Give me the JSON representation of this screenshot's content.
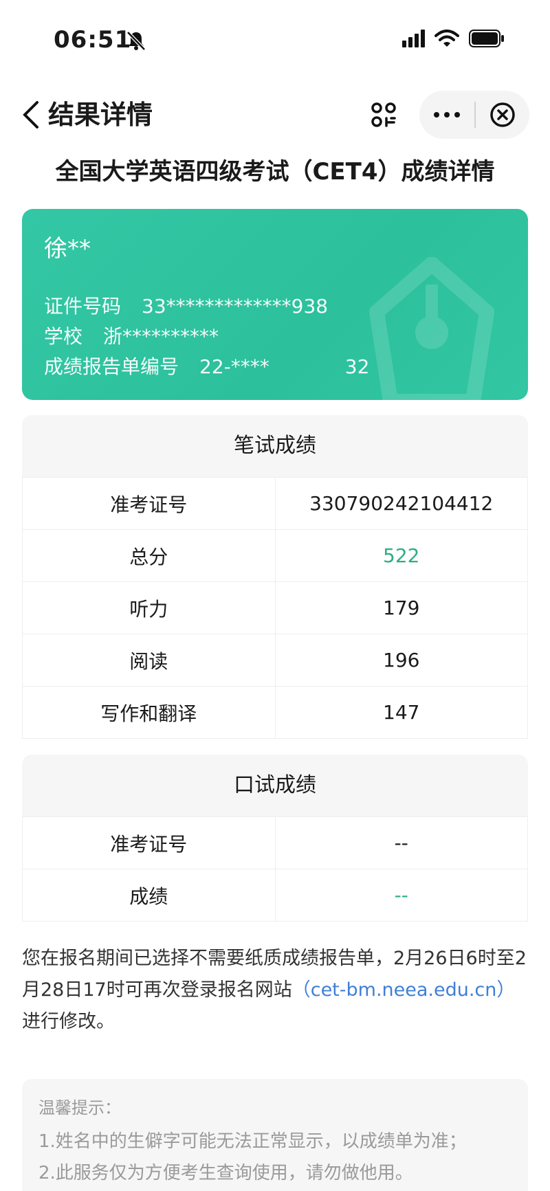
{
  "status_bar": {
    "time": "06:51",
    "icons": [
      "bell-off-icon",
      "signal-icon",
      "wifi-icon",
      "battery-icon"
    ]
  },
  "nav": {
    "back_icon": "chevron-left-icon",
    "title": "结果详情",
    "qr_icon": "qr-scan-icon",
    "more_icon": "more-dots-icon",
    "close_icon": "close-circle-icon"
  },
  "page_title": "全国大学英语四级考试（CET4）成绩详情",
  "card": {
    "name": "徐**",
    "id_label": "证件号码",
    "id_value": "33*************938",
    "school_label": "学校",
    "school_value": "浙**********",
    "report_label": "成绩报告单编号",
    "report_value": "22-****",
    "report_suffix": "32",
    "colors": {
      "background": "#2fc4a0",
      "text": "#ffffff"
    }
  },
  "written": {
    "title": "笔试成绩",
    "rows": [
      {
        "label": "准考证号",
        "value": "330790242104412"
      },
      {
        "label": "总分",
        "value": "522"
      },
      {
        "label": "听力",
        "value": "179"
      },
      {
        "label": "阅读",
        "value": "196"
      },
      {
        "label": "写作和翻译",
        "value": "147"
      }
    ]
  },
  "oral": {
    "title": "口试成绩",
    "rows": [
      {
        "label": "准考证号",
        "value": "--"
      },
      {
        "label": "成绩",
        "value": "--"
      }
    ]
  },
  "notice": {
    "text": "您在报名期间已选择不需要纸质成绩报告单，2月26日6时至2月28日17时可再次登录报名网站",
    "link": "（cet-bm.neea.edu.cn）",
    "tail": "进行修改。"
  },
  "tips": {
    "title": "温馨提示：",
    "items": [
      "1.姓名中的生僻字可能无法正常显示，以成绩单为准；",
      "2.此服务仅为方便考生查询使用，请勿做他用。"
    ]
  },
  "colors": {
    "score_green": "#2cae85",
    "link_blue": "#3f7fd6",
    "section_bg": "#f6f6f6"
  }
}
